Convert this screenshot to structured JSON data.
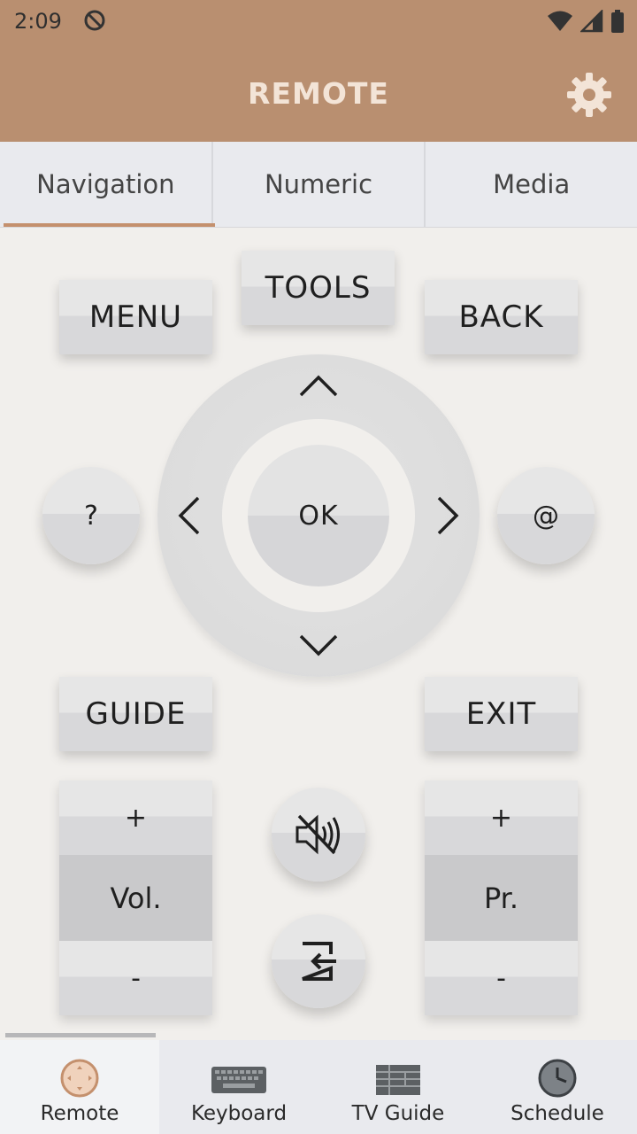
{
  "status_bar": {
    "time": "2:09"
  },
  "app_bar": {
    "title": "REMOTE"
  },
  "tabs": [
    {
      "label": "Navigation",
      "active": true
    },
    {
      "label": "Numeric",
      "active": false
    },
    {
      "label": "Media",
      "active": false
    }
  ],
  "remote": {
    "menu": "MENU",
    "tools": "TOOLS",
    "back": "BACK",
    "help": "?",
    "ok": "OK",
    "at": "@",
    "guide": "GUIDE",
    "exit": "EXIT",
    "vol_plus": "+",
    "vol_label": "Vol.",
    "vol_minus": "-",
    "pr_plus": "+",
    "pr_label": "Pr.",
    "pr_minus": "-"
  },
  "bottom_nav": [
    {
      "label": "Remote",
      "icon": "remote-icon",
      "active": true
    },
    {
      "label": "Keyboard",
      "icon": "keyboard-icon",
      "active": false
    },
    {
      "label": "TV Guide",
      "icon": "tv-guide-icon",
      "active": false
    },
    {
      "label": "Schedule",
      "icon": "clock-icon",
      "active": false
    }
  ],
  "colors": {
    "accent": "#b98f70",
    "tab_indicator": "#c4906d",
    "background": "#f1efec"
  }
}
